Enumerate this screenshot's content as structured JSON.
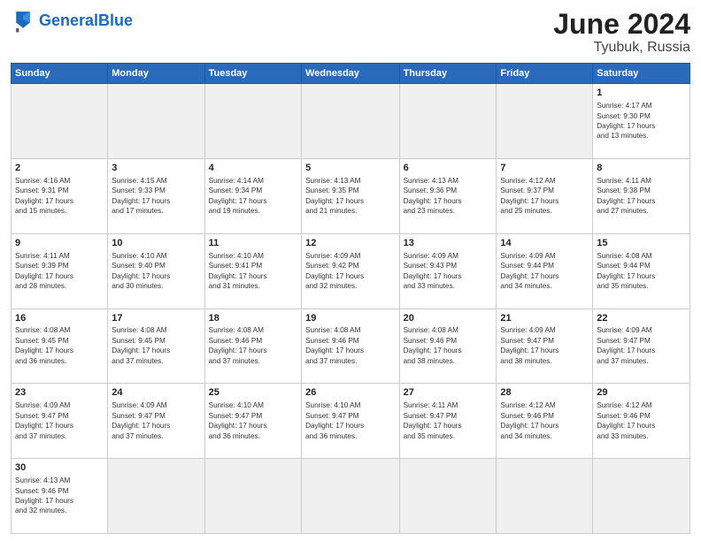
{
  "logo": {
    "text_general": "General",
    "text_blue": "Blue"
  },
  "header": {
    "month": "June 2024",
    "location": "Tyubuk, Russia"
  },
  "weekdays": [
    "Sunday",
    "Monday",
    "Tuesday",
    "Wednesday",
    "Thursday",
    "Friday",
    "Saturday"
  ],
  "weeks": [
    [
      {
        "day": "",
        "info": ""
      },
      {
        "day": "",
        "info": ""
      },
      {
        "day": "",
        "info": ""
      },
      {
        "day": "",
        "info": ""
      },
      {
        "day": "",
        "info": ""
      },
      {
        "day": "",
        "info": ""
      },
      {
        "day": "1",
        "info": "Sunrise: 4:17 AM\nSunset: 9:30 PM\nDaylight: 17 hours\nand 13 minutes."
      }
    ],
    [
      {
        "day": "2",
        "info": "Sunrise: 4:16 AM\nSunset: 9:31 PM\nDaylight: 17 hours\nand 15 minutes."
      },
      {
        "day": "3",
        "info": "Sunrise: 4:15 AM\nSunset: 9:33 PM\nDaylight: 17 hours\nand 17 minutes."
      },
      {
        "day": "4",
        "info": "Sunrise: 4:14 AM\nSunset: 9:34 PM\nDaylight: 17 hours\nand 19 minutes."
      },
      {
        "day": "5",
        "info": "Sunrise: 4:13 AM\nSunset: 9:35 PM\nDaylight: 17 hours\nand 21 minutes."
      },
      {
        "day": "6",
        "info": "Sunrise: 4:13 AM\nSunset: 9:36 PM\nDaylight: 17 hours\nand 23 minutes."
      },
      {
        "day": "7",
        "info": "Sunrise: 4:12 AM\nSunset: 9:37 PM\nDaylight: 17 hours\nand 25 minutes."
      },
      {
        "day": "8",
        "info": "Sunrise: 4:11 AM\nSunset: 9:38 PM\nDaylight: 17 hours\nand 27 minutes."
      }
    ],
    [
      {
        "day": "9",
        "info": "Sunrise: 4:11 AM\nSunset: 9:39 PM\nDaylight: 17 hours\nand 28 minutes."
      },
      {
        "day": "10",
        "info": "Sunrise: 4:10 AM\nSunset: 9:40 PM\nDaylight: 17 hours\nand 30 minutes."
      },
      {
        "day": "11",
        "info": "Sunrise: 4:10 AM\nSunset: 9:41 PM\nDaylight: 17 hours\nand 31 minutes."
      },
      {
        "day": "12",
        "info": "Sunrise: 4:09 AM\nSunset: 9:42 PM\nDaylight: 17 hours\nand 32 minutes."
      },
      {
        "day": "13",
        "info": "Sunrise: 4:09 AM\nSunset: 9:43 PM\nDaylight: 17 hours\nand 33 minutes."
      },
      {
        "day": "14",
        "info": "Sunrise: 4:09 AM\nSunset: 9:44 PM\nDaylight: 17 hours\nand 34 minutes."
      },
      {
        "day": "15",
        "info": "Sunrise: 4:08 AM\nSunset: 9:44 PM\nDaylight: 17 hours\nand 35 minutes."
      }
    ],
    [
      {
        "day": "16",
        "info": "Sunrise: 4:08 AM\nSunset: 9:45 PM\nDaylight: 17 hours\nand 36 minutes."
      },
      {
        "day": "17",
        "info": "Sunrise: 4:08 AM\nSunset: 9:45 PM\nDaylight: 17 hours\nand 37 minutes."
      },
      {
        "day": "18",
        "info": "Sunrise: 4:08 AM\nSunset: 9:46 PM\nDaylight: 17 hours\nand 37 minutes."
      },
      {
        "day": "19",
        "info": "Sunrise: 4:08 AM\nSunset: 9:46 PM\nDaylight: 17 hours\nand 37 minutes."
      },
      {
        "day": "20",
        "info": "Sunrise: 4:08 AM\nSunset: 9:46 PM\nDaylight: 17 hours\nand 38 minutes."
      },
      {
        "day": "21",
        "info": "Sunrise: 4:09 AM\nSunset: 9:47 PM\nDaylight: 17 hours\nand 38 minutes."
      },
      {
        "day": "22",
        "info": "Sunrise: 4:09 AM\nSunset: 9:47 PM\nDaylight: 17 hours\nand 37 minutes."
      }
    ],
    [
      {
        "day": "23",
        "info": "Sunrise: 4:09 AM\nSunset: 9:47 PM\nDaylight: 17 hours\nand 37 minutes."
      },
      {
        "day": "24",
        "info": "Sunrise: 4:09 AM\nSunset: 9:47 PM\nDaylight: 17 hours\nand 37 minutes."
      },
      {
        "day": "25",
        "info": "Sunrise: 4:10 AM\nSunset: 9:47 PM\nDaylight: 17 hours\nand 36 minutes."
      },
      {
        "day": "26",
        "info": "Sunrise: 4:10 AM\nSunset: 9:47 PM\nDaylight: 17 hours\nand 36 minutes."
      },
      {
        "day": "27",
        "info": "Sunrise: 4:11 AM\nSunset: 9:47 PM\nDaylight: 17 hours\nand 35 minutes."
      },
      {
        "day": "28",
        "info": "Sunrise: 4:12 AM\nSunset: 9:46 PM\nDaylight: 17 hours\nand 34 minutes."
      },
      {
        "day": "29",
        "info": "Sunrise: 4:12 AM\nSunset: 9:46 PM\nDaylight: 17 hours\nand 33 minutes."
      }
    ],
    [
      {
        "day": "30",
        "info": "Sunrise: 4:13 AM\nSunset: 9:46 PM\nDaylight: 17 hours\nand 32 minutes."
      },
      {
        "day": "",
        "info": ""
      },
      {
        "day": "",
        "info": ""
      },
      {
        "day": "",
        "info": ""
      },
      {
        "day": "",
        "info": ""
      },
      {
        "day": "",
        "info": ""
      },
      {
        "day": "",
        "info": ""
      }
    ]
  ]
}
